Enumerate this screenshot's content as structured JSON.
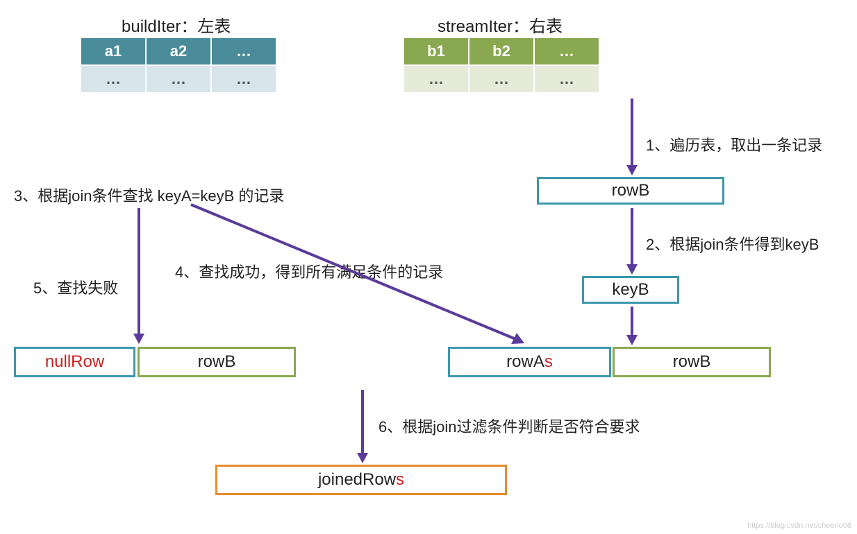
{
  "leftTable": {
    "title": "buildIter：左表",
    "headers": [
      "a1",
      "a2",
      "…"
    ],
    "row": [
      "…",
      "…",
      "…"
    ]
  },
  "rightTable": {
    "title": "streamIter：右表",
    "headers": [
      "b1",
      "b2",
      "…"
    ],
    "row": [
      "…",
      "…",
      "…"
    ]
  },
  "steps": {
    "s1": "1、遍历表，取出一条记录",
    "s2": "2、根据join条件得到keyB",
    "s3": "3、根据join条件查找 keyA=keyB 的记录",
    "s4": "4、查找成功，得到所有满足条件的记录",
    "s5": "5、查找失败",
    "s6": "6、根据join过滤条件判断是否符合要求"
  },
  "boxes": {
    "rowB_top": "rowB",
    "keyB": "keyB",
    "nullRow": "nullRow",
    "rowB_left": "rowB",
    "rowA_pre": "rowA",
    "rowA_suf": "s",
    "rowB_right": "rowB",
    "joined_pre": "joinedRow",
    "joined_suf": "s"
  },
  "watermark": "https://blog.csdn.net/cheerio08"
}
